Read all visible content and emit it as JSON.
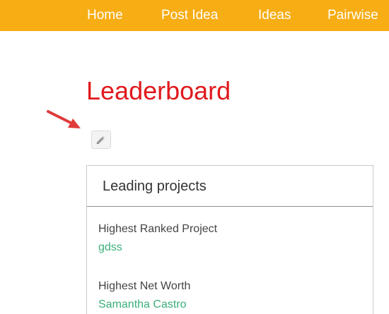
{
  "nav": {
    "items": [
      {
        "label": "Home"
      },
      {
        "label": "Post Idea"
      },
      {
        "label": "Ideas"
      },
      {
        "label": "Pairwise"
      }
    ]
  },
  "page": {
    "title": "Leaderboard"
  },
  "panel": {
    "title": "Leading projects",
    "stats": [
      {
        "label": "Highest Ranked Project",
        "value": "gdss"
      },
      {
        "label": "Highest Net Worth",
        "value": "Samantha Castro"
      }
    ]
  },
  "icons": {
    "edit": "pencil-icon",
    "annotation": "red-arrow-icon"
  },
  "colors": {
    "nav_background": "#f7ad14",
    "title": "#e0191d",
    "link": "#3aaf7a",
    "annotation_arrow": "#e03a3a"
  }
}
